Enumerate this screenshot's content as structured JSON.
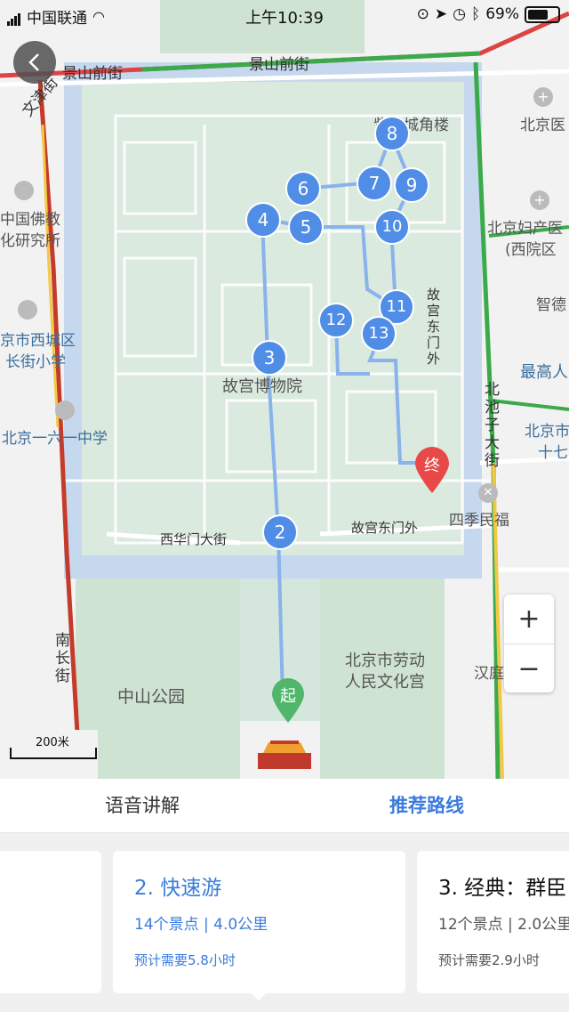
{
  "status": {
    "carrier": "中国联通",
    "time": "上午10:39",
    "battery": "69%"
  },
  "map": {
    "road_labels": [
      "景山前街",
      "景山前街",
      "文津街",
      "南长街",
      "北池子大街",
      "西华门大街",
      "故宫东门外",
      "故宫东门外"
    ],
    "place_labels": [
      "紫禁城角楼",
      "北京医",
      "中国佛教",
      "化研究所",
      "北京妇产医",
      "(西院区",
      "智德",
      "京市西城区",
      "长街小学",
      "最高人",
      "北京一六一中学",
      "北京市",
      "十七",
      "故宫博物院",
      "四季民福",
      "北京市劳动",
      "人民文化宫",
      "中山公园",
      "汉庭"
    ],
    "scale_label": "200米",
    "start_label": "起",
    "end_label": "终",
    "stops": [
      "2",
      "3",
      "4",
      "5",
      "6",
      "7",
      "8",
      "9",
      "10",
      "11",
      "12",
      "13"
    ],
    "colors": {
      "water": "#c6d8ee",
      "park": "#cfe3d2",
      "palace": "#dbeadf",
      "route": "#8ab2ec",
      "stop": "#4f8de6",
      "end_pin": "#e84848",
      "start_pin": "#4fb66a"
    }
  },
  "controls": {
    "zoom_in": "+",
    "zoom_out": "−"
  },
  "tabs": {
    "audio_guide": "语音讲解",
    "recommended_routes": "推荐路线"
  },
  "cards": [
    {
      "title": "2. 快速游",
      "meta": "14个景点 | 4.0公里",
      "time": "预计需要5.8小时"
    },
    {
      "title": "3. 经典：群臣",
      "meta": "12个景点 | 2.0公里",
      "time": "预计需要2.9小时"
    }
  ]
}
